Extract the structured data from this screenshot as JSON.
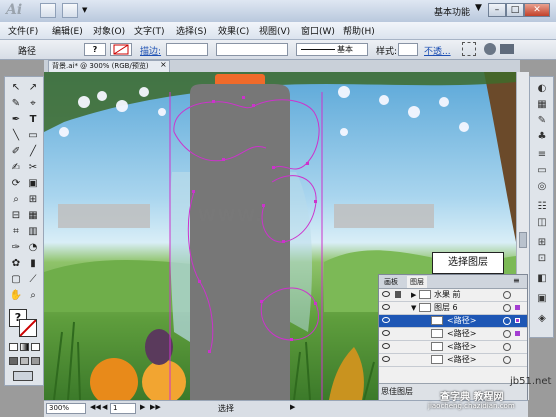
{
  "titlebar": {
    "logo": "Ai",
    "workspace": "基本功能",
    "workspace_arrow": "▼",
    "window_buttons": [
      "–",
      "□",
      "✕"
    ]
  },
  "menubar": {
    "items": [
      "文件(F)",
      "编辑(E)",
      "对象(O)",
      "文字(T)",
      "选择(S)",
      "效果(C)",
      "视图(V)",
      "窗口(W)",
      "帮助(H)"
    ]
  },
  "controlbar": {
    "label": "路径",
    "stroke_label": "描边:",
    "stroke_style": "基本",
    "style_label": "样式:",
    "opacity_link": "不透...",
    "fill_symbol": "?"
  },
  "document": {
    "tab_title": "背景.ai* @ 300% (RGB/预览)",
    "tab_close": "×"
  },
  "tools": {
    "icons": [
      "↖",
      "↗",
      "✎",
      "⌖",
      "T",
      "╲",
      "▭",
      "✐",
      "╱",
      "✂",
      "⟳",
      "▣",
      "⌕",
      "⊞",
      "⊟",
      "▦",
      "⌗",
      "▥",
      "✋",
      "⌕"
    ],
    "fill_symbol": "?"
  },
  "layers_panel": {
    "tabs": [
      "画板",
      "图层"
    ],
    "rows": [
      {
        "name": "水果 前",
        "level": 0,
        "selected": false
      },
      {
        "name": "图层 6",
        "level": 0,
        "selected": false
      },
      {
        "name": "<路径>",
        "level": 1,
        "selected": true
      },
      {
        "name": "<路径>",
        "level": 1,
        "selected": false
      },
      {
        "name": "<路径>",
        "level": 1,
        "selected": false
      },
      {
        "name": "<路径>",
        "level": 1,
        "selected": false
      }
    ],
    "footer_label": "思佳图层"
  },
  "statusbar": {
    "zoom": "300%",
    "page": "1",
    "mode": "选择",
    "nav_first": "◀◀",
    "nav_prev": "◀",
    "nav_next": "▶",
    "nav_last": "▶▶"
  },
  "callout": {
    "text": "选择图层"
  },
  "watermark": {
    "center": "WWW.",
    "bottom_right": "jb51.net",
    "bottom_right_brand": "查字典 教程网",
    "bottom_url": "jiaocheng.chazidian.com"
  },
  "colors": {
    "path_selection": "#cc33cc",
    "bottle_body": "#777777",
    "bottle_cap": "#f06a2a",
    "selected_row": "#1e57b5"
  }
}
